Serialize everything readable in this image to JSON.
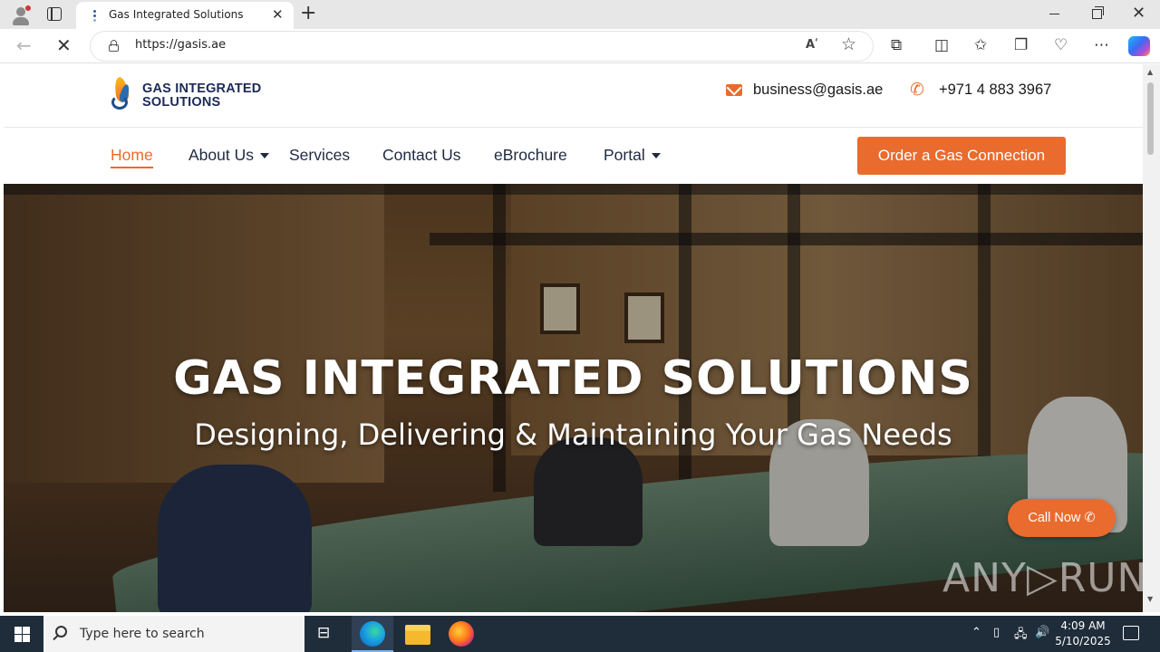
{
  "browser": {
    "tab_title": "Gas Integrated Solutions",
    "url": "https://gasis.ae",
    "read_aloud": "Aʹ"
  },
  "site": {
    "logo_line1": "GAS INTEGRATED",
    "logo_line2": "SOLUTIONS",
    "email": "business@gasis.ae",
    "phone": "+971 4 883 3967",
    "nav": [
      {
        "label": "Home"
      },
      {
        "label": "About Us"
      },
      {
        "label": "Services"
      },
      {
        "label": "Contact Us"
      },
      {
        "label": "eBrochure"
      },
      {
        "label": "Portal"
      }
    ],
    "order_button": "Order a Gas Connection"
  },
  "hero": {
    "title": "GAS INTEGRATED SOLUTIONS",
    "subtitle": "Designing, Delivering & Maintaining Your Gas Needs",
    "call_button": "Call Now",
    "watermark": "ANY▷RUN"
  },
  "taskbar": {
    "search_placeholder": "Type here to search",
    "time": "4:09 AM",
    "date": "5/10/2025"
  },
  "colors": {
    "accent": "#ea6b2e",
    "navy": "#1d2a57",
    "taskbar": "#1f2c3a"
  }
}
